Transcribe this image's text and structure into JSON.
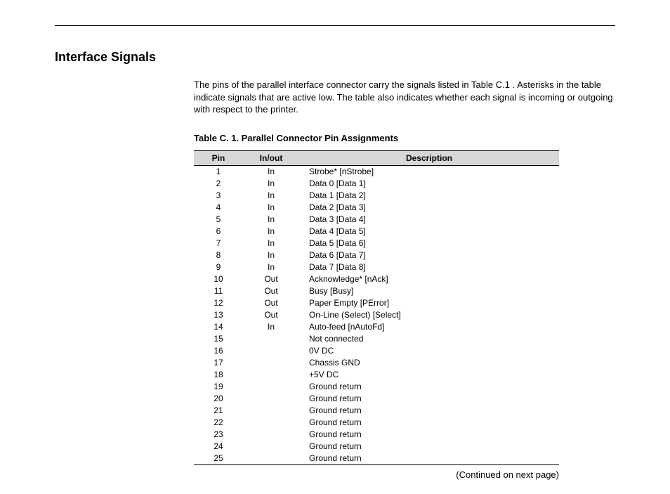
{
  "heading": "Interface Signals",
  "intro": "The pins of the parallel interface connector carry the signals listed in Table C.1 . Asterisks in the table indicate signals that are active low. The table also indicates whether each signal is incoming or outgoing with respect to the printer.",
  "table_caption": "Table C. 1.  Parallel Connector Pin Assignments",
  "columns": {
    "pin": "Pin",
    "io": "In/out",
    "desc": "Description"
  },
  "rows": [
    {
      "pin": "1",
      "io": "In",
      "desc": "Strobe* [nStrobe]"
    },
    {
      "pin": "2",
      "io": "In",
      "desc": "Data 0 [Data 1]"
    },
    {
      "pin": "3",
      "io": "In",
      "desc": "Data 1 [Data 2]"
    },
    {
      "pin": "4",
      "io": "In",
      "desc": "Data 2 [Data 3]"
    },
    {
      "pin": "5",
      "io": "In",
      "desc": "Data 3 [Data 4]"
    },
    {
      "pin": "6",
      "io": "In",
      "desc": "Data 4 [Data 5]"
    },
    {
      "pin": "7",
      "io": "In",
      "desc": "Data 5 [Data 6]"
    },
    {
      "pin": "8",
      "io": "In",
      "desc": "Data 6 [Data 7]"
    },
    {
      "pin": "9",
      "io": "In",
      "desc": "Data 7 [Data 8]"
    },
    {
      "pin": "10",
      "io": "Out",
      "desc": "Acknowledge* [nAck]"
    },
    {
      "pin": "11",
      "io": "Out",
      "desc": "Busy [Busy]"
    },
    {
      "pin": "12",
      "io": "Out",
      "desc": "Paper Empty [PError]"
    },
    {
      "pin": "13",
      "io": "Out",
      "desc": "On-Line (Select) [Select]"
    },
    {
      "pin": "14",
      "io": "In",
      "desc": "Auto-feed [nAutoFd]"
    },
    {
      "pin": "15",
      "io": "",
      "desc": "Not connected"
    },
    {
      "pin": "16",
      "io": "",
      "desc": "0V DC"
    },
    {
      "pin": "17",
      "io": "",
      "desc": "Chassis GND"
    },
    {
      "pin": "18",
      "io": "",
      "desc": "+5V DC"
    },
    {
      "pin": "19",
      "io": "",
      "desc": "Ground return"
    },
    {
      "pin": "20",
      "io": "",
      "desc": "Ground return"
    },
    {
      "pin": "21",
      "io": "",
      "desc": "Ground return"
    },
    {
      "pin": "22",
      "io": "",
      "desc": "Ground return"
    },
    {
      "pin": "23",
      "io": "",
      "desc": "Ground return"
    },
    {
      "pin": "24",
      "io": "",
      "desc": "Ground return"
    },
    {
      "pin": "25",
      "io": "",
      "desc": "Ground return"
    }
  ],
  "continued": "(Continued on next page)"
}
